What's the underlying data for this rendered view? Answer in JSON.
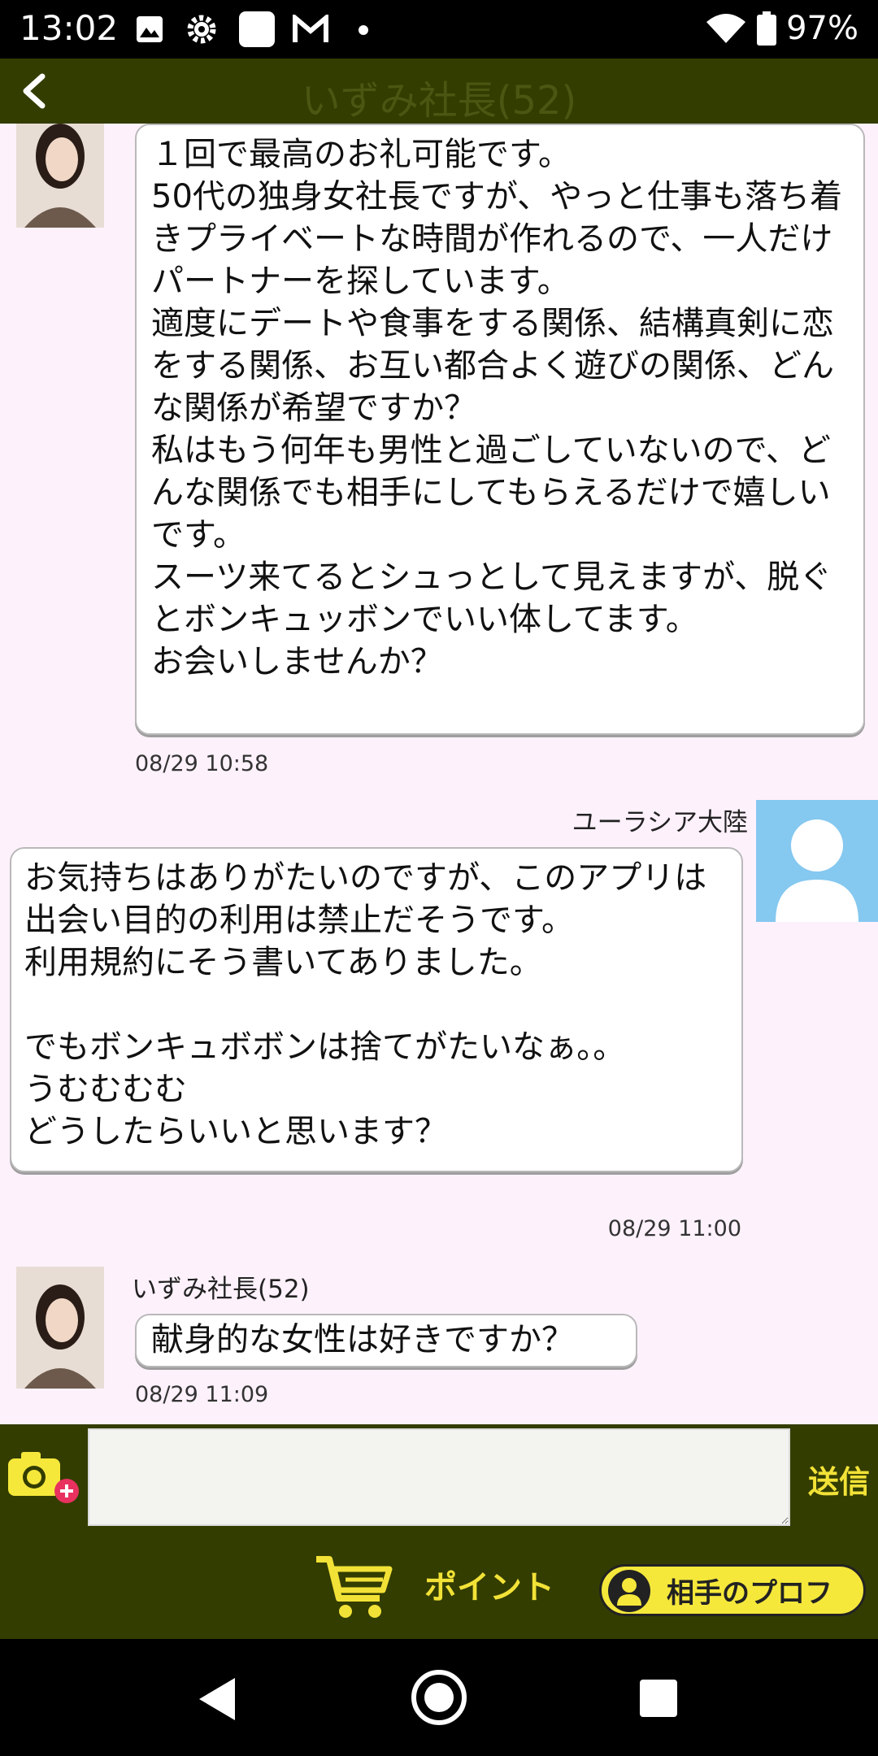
{
  "status_bar": {
    "time": "13:02",
    "battery": "97%"
  },
  "header": {
    "title": "いずみ社長(52)"
  },
  "messages": [
    {
      "from": "partner",
      "text": "１回で最高のお礼可能です。\n50代の独身女社長ですが、やっと仕事も落ち着きプライベートな時間が作れるので、一人だけパートナーを探しています。\n適度にデートや食事をする関係、結構真剣に恋をする関係、お互い都合よく遊びの関係、どんな関係が希望ですか？\n私はもう何年も男性と過ごしていないので、どんな関係でも相手にしてもらえるだけで嬉しいです。\nスーツ来てるとシュっとして見えますが、脱ぐとボンキュッボンでいい体してます。\nお会いしませんか？",
      "time": "08/29 10:58"
    },
    {
      "from": "me",
      "sender": "ユーラシア大陸",
      "text": "お気持ちはありがたいのですが、このアプリは出会い目的の利用は禁止だそうです。\n利用規約にそう書いてありました。\n\nでもボンキュボボンは捨てがたいなぁ。。\nうむむむむ\nどうしたらいいと思います？",
      "time": "08/29 11:00"
    },
    {
      "from": "partner",
      "sender": "いずみ社長(52)",
      "text": "献身的な女性は好きですか？",
      "time": "08/29 11:09"
    }
  ],
  "composer": {
    "input_value": "",
    "send_label": "送信",
    "points_label": "ポイント",
    "profile_label": "相手のプロフ"
  },
  "colors": {
    "header_bg": "#333d00",
    "accent_yellow": "#f5e83b",
    "chat_bg": "#fdf1fb"
  }
}
